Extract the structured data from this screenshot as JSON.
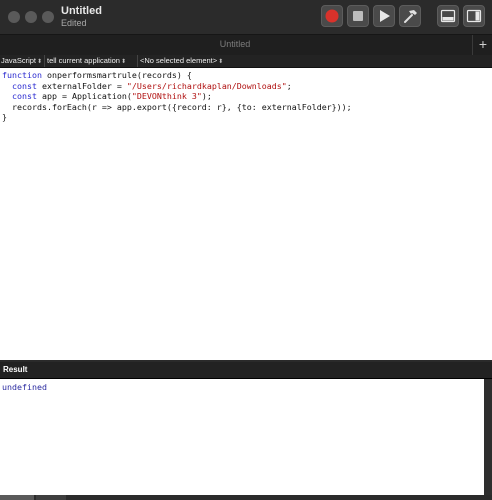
{
  "window": {
    "title": "Untitled",
    "subtitle": "Edited"
  },
  "tab": {
    "label": "Untitled",
    "new_tab_label": "+"
  },
  "navigation": {
    "language": "JavaScript",
    "target": "tell current application",
    "element": "<No selected element>"
  },
  "editor": {
    "lines": [
      [
        {
          "t": "function",
          "c": "kw"
        },
        {
          "t": " onperformsmartrule(records) {",
          "c": ""
        }
      ],
      [
        {
          "t": "  ",
          "c": ""
        },
        {
          "t": "const",
          "c": "kw"
        },
        {
          "t": " externalFolder = ",
          "c": ""
        },
        {
          "t": "\"/Users/richardkaplan/Downloads\"",
          "c": "str"
        },
        {
          "t": ";",
          "c": ""
        }
      ],
      [
        {
          "t": "  ",
          "c": ""
        },
        {
          "t": "const",
          "c": "kw"
        },
        {
          "t": " app = Application(",
          "c": ""
        },
        {
          "t": "\"DEVONthink 3\"",
          "c": "str"
        },
        {
          "t": ");",
          "c": ""
        }
      ],
      [
        {
          "t": "  records.forEach(r => app.export({record: r}, {to: externalFolder}));",
          "c": ""
        }
      ],
      [
        {
          "t": "}",
          "c": ""
        }
      ]
    ]
  },
  "result": {
    "header": "Result",
    "value": "undefined"
  },
  "colors": {
    "record_button": "#d9322b",
    "titlebar": "#2b2b2b",
    "keyword": "#2a2ad0",
    "string": "#b01010"
  }
}
